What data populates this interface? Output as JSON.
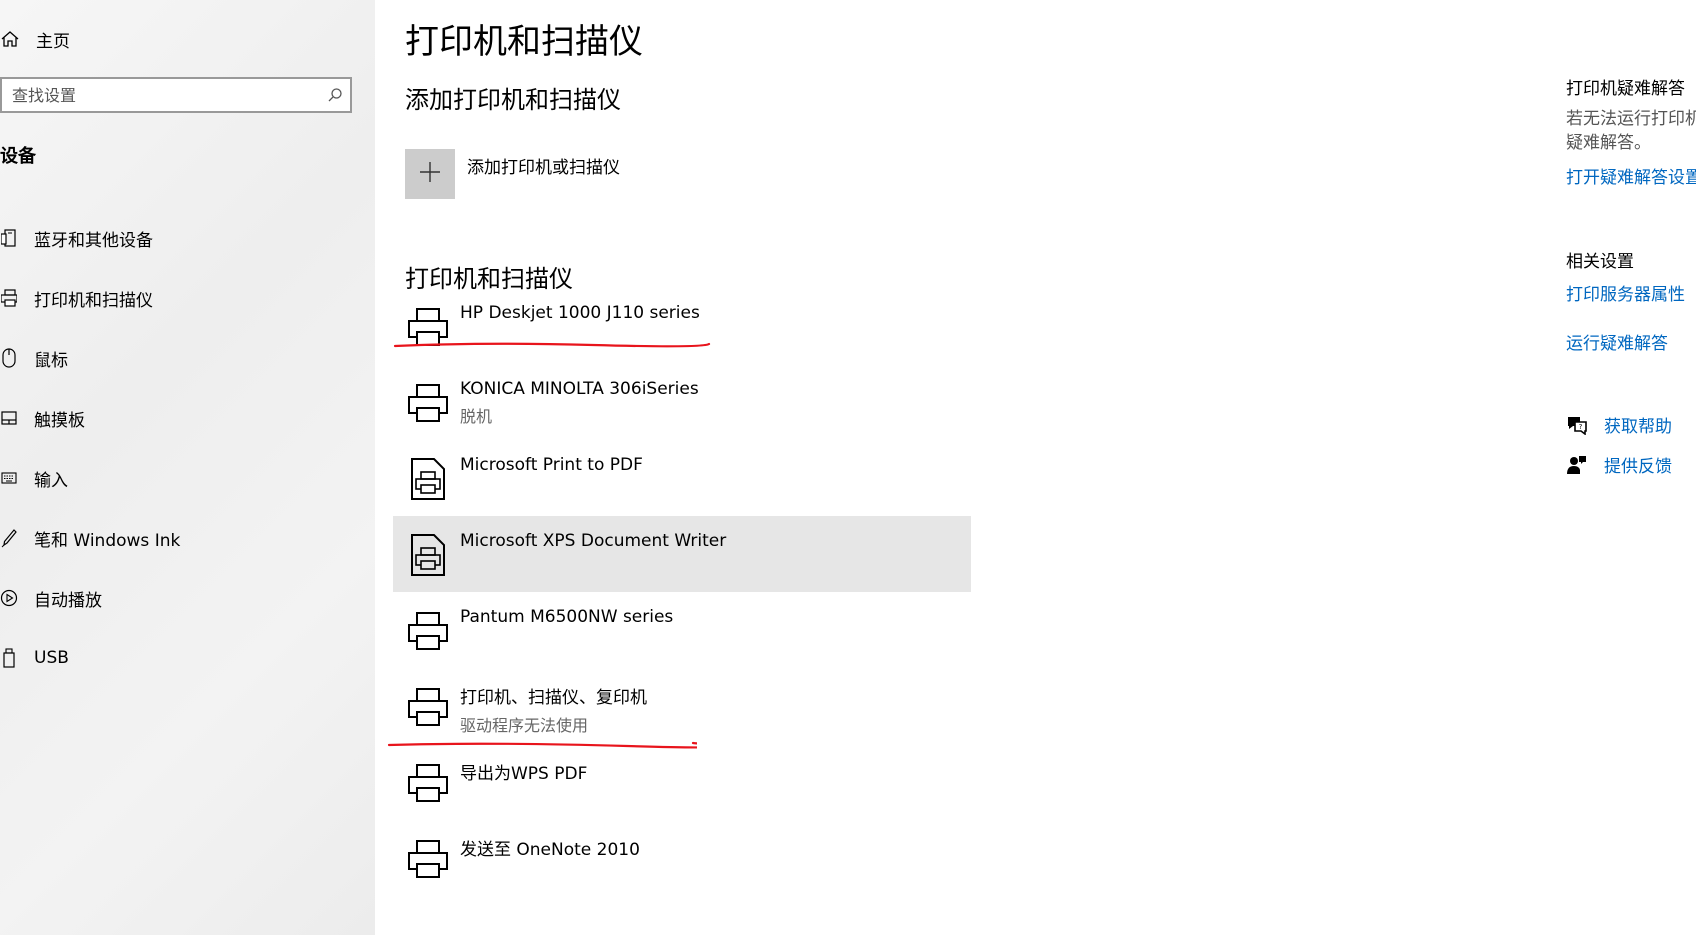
{
  "sidebar": {
    "home_label": "主页",
    "search_placeholder": "查找设置",
    "section_title": "设备",
    "items": [
      {
        "label": "蓝牙和其他设备",
        "icon": "bluetooth-device-icon"
      },
      {
        "label": "打印机和扫描仪",
        "icon": "printer-icon"
      },
      {
        "label": "鼠标",
        "icon": "mouse-icon"
      },
      {
        "label": "触摸板",
        "icon": "touchpad-icon"
      },
      {
        "label": "输入",
        "icon": "keyboard-icon"
      },
      {
        "label": "笔和 Windows Ink",
        "icon": "pen-icon"
      },
      {
        "label": "自动播放",
        "icon": "autoplay-icon"
      },
      {
        "label": "USB",
        "icon": "usb-icon"
      }
    ]
  },
  "main": {
    "title": "打印机和扫描仪",
    "add_section_title": "添加打印机和扫描仪",
    "add_button_label": "添加打印机或扫描仪",
    "list_section_title": "打印机和扫描仪",
    "devices": [
      {
        "name": "HP Deskjet 1000 J110 series",
        "status": "",
        "icon": "printer-icon"
      },
      {
        "name": "KONICA MINOLTA 306iSeries",
        "status": "脱机",
        "icon": "printer-icon"
      },
      {
        "name": "Microsoft Print to PDF",
        "status": "",
        "icon": "document-printer-icon"
      },
      {
        "name": "Microsoft XPS Document Writer",
        "status": "",
        "icon": "document-printer-icon"
      },
      {
        "name": "Pantum M6500NW series",
        "status": "",
        "icon": "printer-icon"
      },
      {
        "name": "打印机、扫描仪、复印机",
        "status": "驱动程序无法使用",
        "icon": "printer-icon"
      },
      {
        "name": "导出为WPS PDF",
        "status": "",
        "icon": "printer-icon"
      },
      {
        "name": "发送至 OneNote 2010",
        "status": "",
        "icon": "printer-icon"
      }
    ]
  },
  "right": {
    "troubleshoot_title": "打印机疑难解答",
    "troubleshoot_text_1": "若无法运行打印机",
    "troubleshoot_text_2": "疑难解答。",
    "troubleshoot_link": "打开疑难解答设置",
    "related_title": "相关设置",
    "print_server_link": "打印服务器属性",
    "run_troubleshooter_link": "运行疑难解答",
    "get_help_label": "获取帮助",
    "feedback_label": "提供反馈"
  },
  "colors": {
    "accent": "#0067c0",
    "selected_row": "#e6e6e6",
    "annotation_red": "#e8141c"
  }
}
